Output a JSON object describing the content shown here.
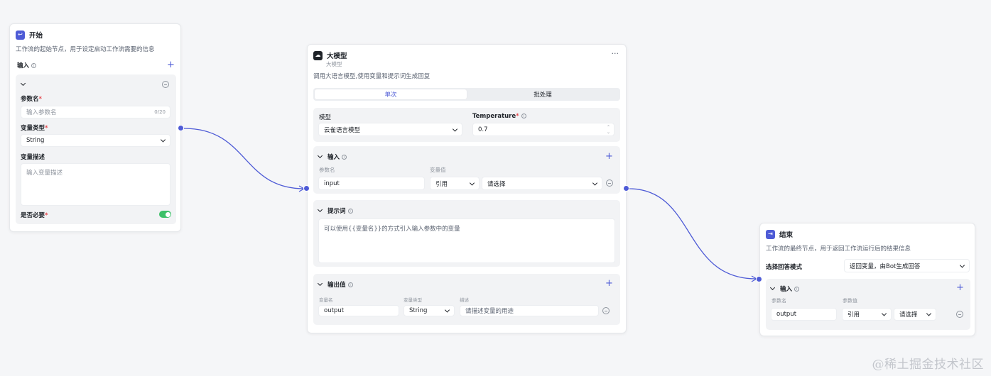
{
  "accent_color": "#4e5bd6",
  "toggle_color": "#3cc068",
  "start_node": {
    "title": "开始",
    "description": "工作流的起始节点，用于设定启动工作流需要的信息",
    "input_label": "输入",
    "param_name_label": "参数名",
    "param_name_placeholder": "输入参数名",
    "param_name_counter": "0/20",
    "var_type_label": "变量类型",
    "var_type_value": "String",
    "var_desc_label": "变量描述",
    "var_desc_placeholder": "输入变量描述",
    "required_label": "是否必要",
    "required_mark": "*",
    "required_on": true
  },
  "llm_node": {
    "title": "大模型",
    "subtitle": "大模型",
    "more": "···",
    "description": "调用大语言模型,使用变量和提示词生成回复",
    "tabs": [
      {
        "label": "单次",
        "active": true
      },
      {
        "label": "批处理",
        "active": false
      }
    ],
    "model_label": "模型",
    "model_value": "云雀语言模型",
    "temperature_label": "Temperature",
    "temperature_value": "0.7",
    "input_section": "输入",
    "param_name_header": "参数名",
    "var_value_header": "变量值",
    "input_row": {
      "name": "input",
      "source": "引用",
      "select": "请选择"
    },
    "prompt_section": "提示词",
    "prompt_placeholder": "可以使用{{变量名}}的方式引入输入参数中的变量",
    "output_section": "输出值",
    "out_name_header": "变量名",
    "out_type_header": "变量类型",
    "out_desc_header": "描述",
    "output_row": {
      "name": "output",
      "type": "String",
      "desc_placeholder": "请描述变量的用途"
    }
  },
  "end_node": {
    "title": "结束",
    "description": "工作流的最终节点，用于返回工作流运行后的结果信息",
    "mode_label": "选择回答模式",
    "mode_value": "返回变量，由Bot生成回答",
    "input_section": "输入",
    "param_name_header": "参数名",
    "param_value_header": "参数值",
    "row": {
      "name": "output",
      "source": "引用",
      "select": "请选择"
    }
  },
  "watermark": "@稀土掘金技术社区"
}
